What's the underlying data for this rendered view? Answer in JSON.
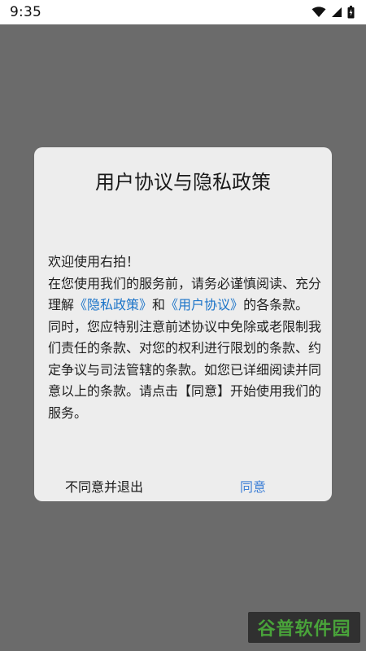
{
  "status_bar": {
    "time": "9:35",
    "icons": [
      "wifi-icon",
      "signal-icon",
      "battery-icon"
    ]
  },
  "dialog": {
    "title": "用户协议与隐私政策",
    "greeting": "欢迎使用右拍！",
    "body_part1": "在您使用我们的服务前，请务必谨慎阅读、充分理解",
    "privacy_link": "《隐私政策》",
    "and_text": "和",
    "user_agreement_link": "《用户协议》",
    "body_part2": "的各条款。同时，您应特别注意前述协议中免除或老限制我们责任的条款、对您的权利进行限划的条款、约定争议与司法管辖的条款。如您已详细阅读并同意以上的条款。请点击【同意】开始使用我们的服务。",
    "disagree_label": "不同意并退出",
    "agree_label": "同意"
  },
  "watermark": {
    "text": "谷普软件园"
  },
  "colors": {
    "overlay": "#6b6b6b",
    "dialog_bg": "#ededed",
    "link": "#1a73c8",
    "agree": "#3d7fd6",
    "watermark_text": "#49a33a"
  }
}
